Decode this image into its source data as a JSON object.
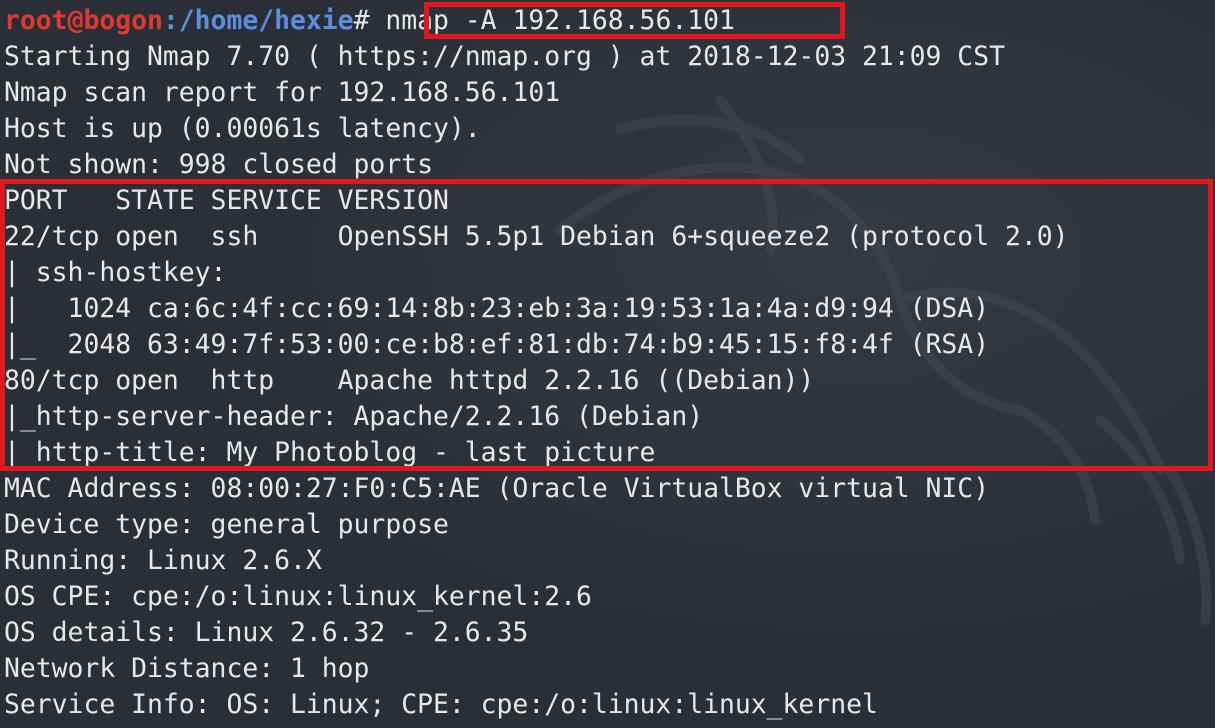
{
  "prompt": {
    "user_host": "root@bogon",
    "path": ":/home/hexie",
    "symbol": "#",
    "command": " nmap -A 192.168.56.101"
  },
  "output": [
    "Starting Nmap 7.70 ( https://nmap.org ) at 2018-12-03 21:09 CST",
    "Nmap scan report for 192.168.56.101",
    "Host is up (0.00061s latency).",
    "Not shown: 998 closed ports",
    "PORT   STATE SERVICE VERSION",
    "22/tcp open  ssh     OpenSSH 5.5p1 Debian 6+squeeze2 (protocol 2.0)",
    "| ssh-hostkey:",
    "|   1024 ca:6c:4f:cc:69:14:8b:23:eb:3a:19:53:1a:4a:d9:94 (DSA)",
    "|_  2048 63:49:7f:53:00:ce:b8:ef:81:db:74:b9:45:15:f8:4f (RSA)",
    "80/tcp open  http    Apache httpd 2.2.16 ((Debian))",
    "|_http-server-header: Apache/2.2.16 (Debian)",
    "|_http-title: My Photoblog - last picture",
    "MAC Address: 08:00:27:F0:C5:AE (Oracle VirtualBox virtual NIC)",
    "Device type: general purpose",
    "Running: Linux 2.6.X",
    "OS CPE: cpe:/o:linux:linux_kernel:2.6",
    "OS details: Linux 2.6.32 - 2.6.35",
    "Network Distance: 1 hop",
    "Service Info: OS: Linux; CPE: cpe:/o:linux:linux_kernel"
  ],
  "colors": {
    "background": "#2a2e36",
    "text": "#e8e8e8",
    "prompt_user": "#e0392f",
    "prompt_path": "#5a8fdc",
    "highlight": "#e0171c"
  },
  "icons": {
    "wallpaper": "kali-dragon-icon"
  }
}
